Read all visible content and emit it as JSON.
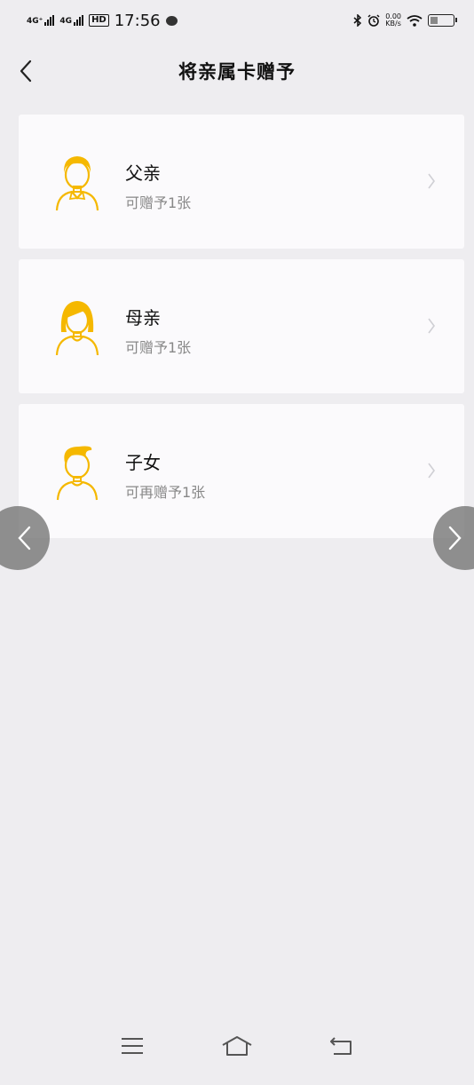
{
  "status": {
    "network1": "4G⁺",
    "network2": "4G",
    "hd_label": "HD",
    "time": "17:56",
    "speed_value": "0.00",
    "speed_unit": "KB/s",
    "battery_percent": 0.35
  },
  "header": {
    "title": "将亲属卡赠予",
    "back_icon": "chevron-left-icon"
  },
  "cards": [
    {
      "name": "父亲",
      "sub": "可赠予1张",
      "avatar": "father-avatar-icon"
    },
    {
      "name": "母亲",
      "sub": "可赠予1张",
      "avatar": "mother-avatar-icon"
    },
    {
      "name": "子女",
      "sub": "可再赠予1张",
      "avatar": "child-avatar-icon"
    }
  ],
  "colors": {
    "accent": "#f5b800",
    "background": "#eeedf0",
    "card": "#fbfafc",
    "subtext": "#888888"
  },
  "nav": {
    "menu_icon": "menu-icon",
    "home_icon": "home-icon",
    "back_icon": "back-icon"
  }
}
